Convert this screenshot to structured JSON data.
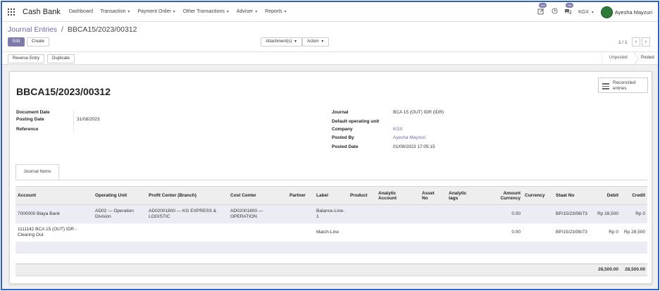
{
  "navbar": {
    "app_name": "Cash Bank",
    "menus": [
      "Dashboard",
      "Transaction",
      "Payment Order",
      "Other Transactions",
      "Adviser",
      "Reports"
    ],
    "menus_with_caret": [
      false,
      true,
      true,
      true,
      true,
      true
    ],
    "activity_count": "154",
    "message_count": "156",
    "company": "KGX",
    "user_name": "Ayesha Mayzuri"
  },
  "breadcrumb": {
    "parent": "Journal Entries",
    "separator": "/",
    "current": "BBCA15/2023/00312"
  },
  "buttons": {
    "edit": "Edit",
    "create": "Create",
    "attachments": "Attachment(s)",
    "action": "Action",
    "reverse_entry": "Reverse Entry",
    "duplicate": "Duplicate",
    "reconciled_line1": "Reconciled",
    "reconciled_line2": "entries"
  },
  "pager": {
    "text": "1 / 1",
    "prev": "‹",
    "next": "›"
  },
  "status": {
    "unposted": "Unposted",
    "posted": "Posted"
  },
  "form": {
    "title": "BBCA15/2023/00312",
    "left": {
      "document_date_label": "Document Date",
      "posting_date_label": "Posting Date",
      "posting_date": "31/08/2023",
      "reference_label": "Reference"
    },
    "right": {
      "journal_label": "Journal",
      "journal": "BCA 15 (OUT) IDR (IDR)",
      "operating_unit_label": "Default operating unit",
      "company_label": "Company",
      "company": "KGX",
      "posted_by_label": "Posted By",
      "posted_by": "Ayesha Mayzuri",
      "posted_date_label": "Posted Date",
      "posted_date": "01/09/2023 17:05:15"
    }
  },
  "tabs": {
    "journal_items": "Journal Items"
  },
  "table": {
    "headers": {
      "account": "Account",
      "operating_unit": "Operating Unit",
      "profit_center": "Profit Center (Branch)",
      "cost_center": "Cost Center",
      "partner": "Partner",
      "label": "Label",
      "product": "Product",
      "analytic_account_1": "Analytic",
      "analytic_account_2": "Account",
      "asset_no_1": "Asset",
      "asset_no_2": "No",
      "analytic_tags_1": "Analytic",
      "analytic_tags_2": "tags",
      "amount_currency_1": "Amount",
      "amount_currency_2": "Currency",
      "currency": "Currency",
      "staat_no": "Staat No",
      "debit": "Debit",
      "credit": "Credit"
    },
    "rows": [
      {
        "account": "7000000 Biaya Bank",
        "operating_unit": "AD02 — Operation Division",
        "profit_center": "AD02001800 — KG EXPRESS & LOGISTIC",
        "cost_center": "AD02001800 — OPERATION",
        "partner": "",
        "label": "Balance-Line-1",
        "product": "",
        "analytic_account": "",
        "asset_no": "",
        "analytic_tags": "",
        "amount_currency": "0.00",
        "currency": "",
        "staat_no": "BP/15/23/08/73",
        "debit": "Rp 28,500",
        "credit": "Rp 0"
      },
      {
        "account": "1111142 BCA 15 (OUT) IDR - Clearing Out",
        "operating_unit": "",
        "profit_center": "",
        "cost_center": "",
        "partner": "",
        "label": "Match-Line",
        "product": "",
        "analytic_account": "",
        "asset_no": "",
        "analytic_tags": "",
        "amount_currency": "0.00",
        "currency": "",
        "staat_no": "BP/15/23/08/73",
        "debit": "Rp 0",
        "credit": "Rp 28,500"
      }
    ],
    "totals": {
      "debit": "28,500.00",
      "credit": "28,500.00"
    }
  },
  "colors": {
    "accent": "#7c7bad",
    "link": "#6b6ba3",
    "frame_border": "#2f62c9",
    "selected_row": "#ececf4"
  }
}
